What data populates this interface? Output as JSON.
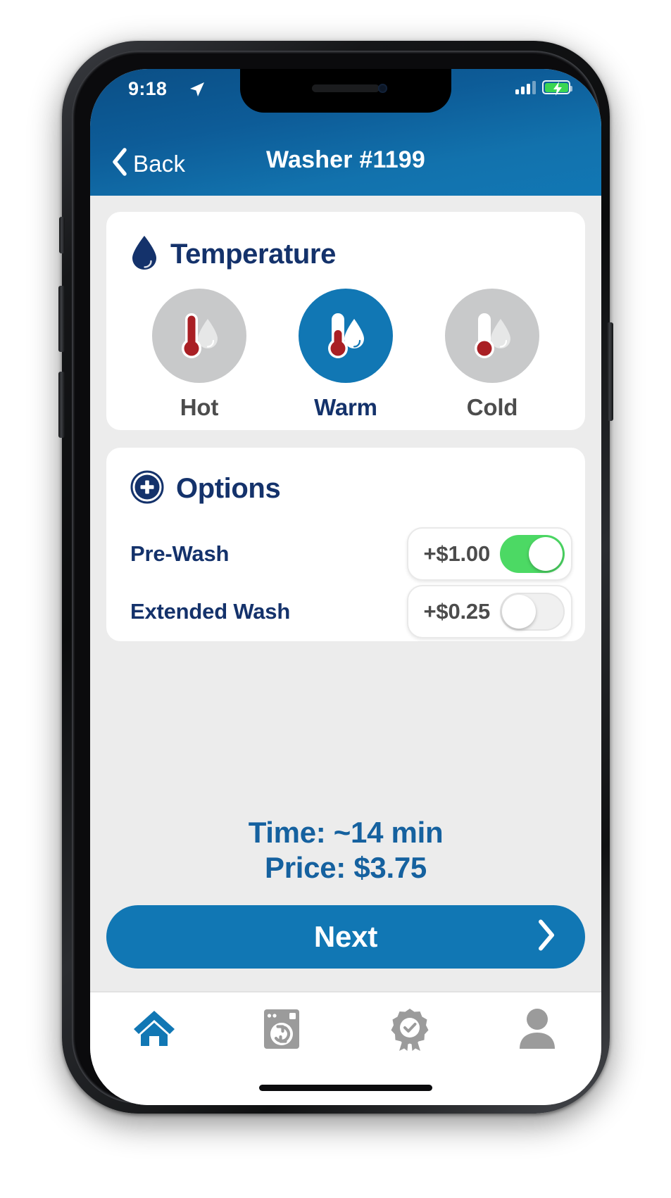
{
  "status_bar": {
    "time": "9:18",
    "location_icon": "location-arrow-icon",
    "signal_icon": "cellular-signal-icon",
    "battery_icon": "battery-charging-icon"
  },
  "nav": {
    "back_label": "Back",
    "back_icon": "chevron-left-icon",
    "title": "Washer #1199"
  },
  "temperature": {
    "title": "Temperature",
    "icon": "water-drop-icon",
    "selected": "Warm",
    "options": [
      {
        "label": "Hot",
        "icon": "thermometer-hot-icon",
        "selected": false
      },
      {
        "label": "Warm",
        "icon": "thermometer-warm-icon",
        "selected": true
      },
      {
        "label": "Cold",
        "icon": "thermometer-cold-icon",
        "selected": false
      }
    ]
  },
  "options": {
    "title": "Options",
    "icon": "plus-circle-icon",
    "items": [
      {
        "label": "Pre-Wash",
        "price": "+$1.00",
        "enabled": true
      },
      {
        "label": "Extended Wash",
        "price": "+$0.25",
        "enabled": false
      }
    ]
  },
  "summary": {
    "time_line": "Time: ~14 min",
    "price_line": "Price: $3.75"
  },
  "next_button": {
    "label": "Next",
    "icon": "chevron-right-icon"
  },
  "tab_bar": {
    "items": [
      {
        "name": "home",
        "icon": "home-icon",
        "active": true
      },
      {
        "name": "machines",
        "icon": "washer-icon",
        "active": false
      },
      {
        "name": "rewards",
        "icon": "award-icon",
        "active": false
      },
      {
        "name": "account",
        "icon": "person-icon",
        "active": false
      }
    ]
  },
  "colors": {
    "brand_blue": "#1177b4",
    "navy": "#14326b",
    "summary_blue": "#15619f",
    "toggle_on_green": "#4cd964",
    "inactive_gray": "#c8c9ca",
    "screen_bg": "#ececec"
  }
}
